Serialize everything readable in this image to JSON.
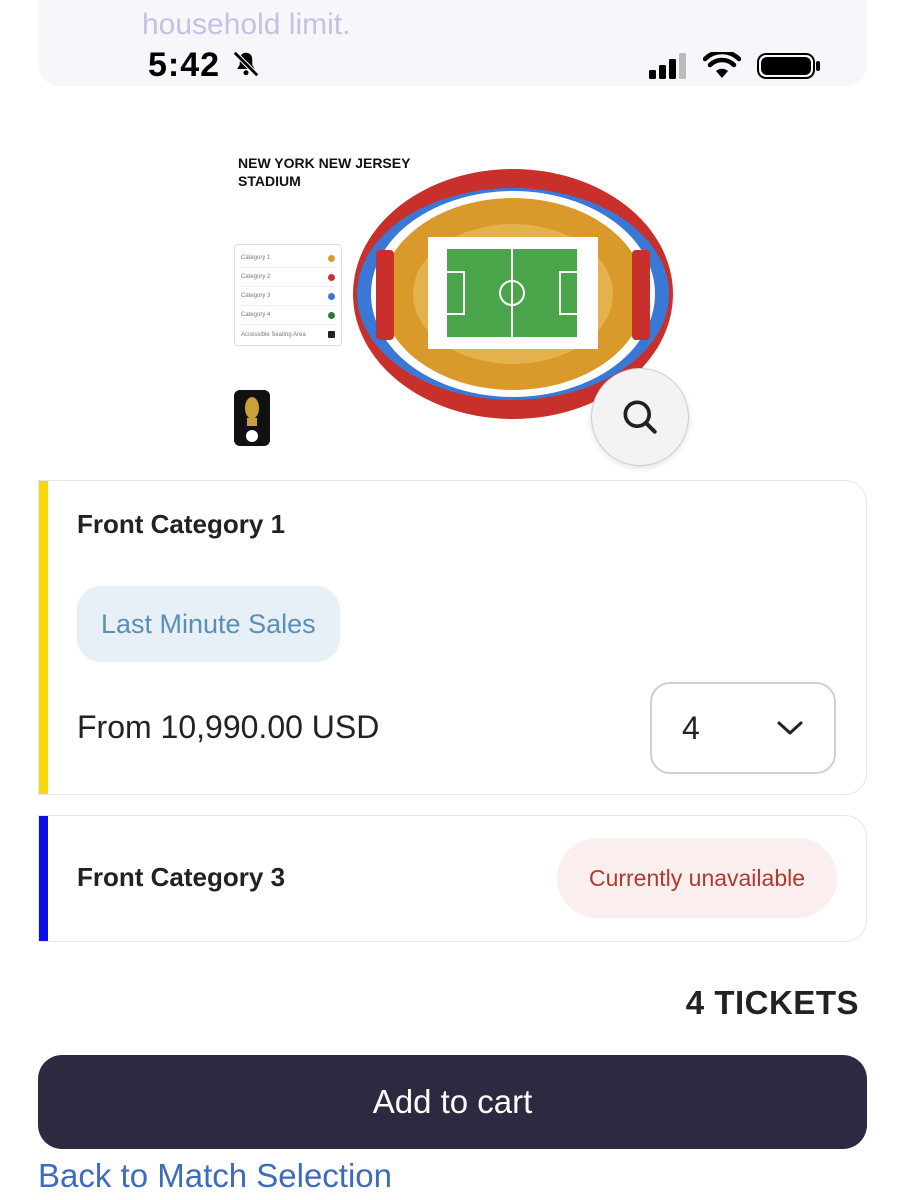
{
  "banner": {
    "text": "household limit."
  },
  "status_bar": {
    "time": "5:42",
    "icons": [
      "bell-slash-icon",
      "signal-icon",
      "wifi-icon",
      "battery-icon"
    ]
  },
  "stadium_map": {
    "title": "NEW YORK NEW JERSEY STADIUM",
    "legend": [
      {
        "label": "Category 1",
        "color": "#d99a2b"
      },
      {
        "label": "Category 2",
        "color": "#c8302c"
      },
      {
        "label": "Category 3",
        "color": "#3a78d6"
      },
      {
        "label": "Category 4",
        "color": "#2e7a3e"
      },
      {
        "label": "Accessible Seating Area",
        "color": "#222222"
      }
    ]
  },
  "categories": [
    {
      "name": "Front Category 1",
      "accent": "#f5d90a",
      "tag": "Last Minute Sales",
      "price": "From 10,990.00 USD",
      "quantity": "4"
    },
    {
      "name": "Front Category 3",
      "accent": "#0a10e6",
      "status": "Currently unavailable"
    }
  ],
  "summary": {
    "tickets": "4 TICKETS"
  },
  "actions": {
    "add_to_cart": "Add to cart",
    "back_link": "Back to Match Selection"
  },
  "colors": {
    "primary_button": "#2c2940",
    "link": "#3d6bbf",
    "unavailable_text": "#b23a2c"
  }
}
